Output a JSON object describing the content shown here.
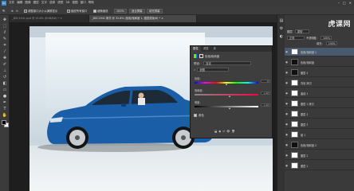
{
  "app": {
    "icon": "Ps"
  },
  "menu": [
    "文件",
    "编辑",
    "图像",
    "图层",
    "文字",
    "选择",
    "滤镜",
    "3D",
    "视图",
    "窗口",
    "帮助"
  ],
  "window_controls": [
    "minimize-icon",
    "maximize-icon",
    "close-icon"
  ],
  "options": {
    "checkbox1_label": "调整窗口大小以满屏显示",
    "checkbox2_label": "缩放所有窗口",
    "checkbox3_label": "细微缩放",
    "zoom_value": "100%",
    "fit_screen": "适合屏幕",
    "fill_screen": "填充屏幕"
  },
  "tabs": [
    {
      "label": "_DSC1941.psd @ 15.6% (RGB/8#) * ×",
      "active": false
    },
    {
      "label": "_DSC1941 拷贝 @ 32.8% (色相/饱和度 1, 图层蒙版/8) * ×",
      "active": true
    }
  ],
  "properties": {
    "tabs": [
      "属性",
      "调整",
      "库"
    ],
    "active_tab": "属性",
    "title": "色相/饱和度",
    "preset_label": "预设：",
    "preset_value": "自定",
    "channel_value": "全图",
    "hue_label": "色相：",
    "hue_value": "0",
    "saturation_label": "饱和度：",
    "saturation_value": "+12",
    "lightness_label": "明度：",
    "lightness_value": "+12",
    "colorize_label": "着色",
    "slider_levels": {
      "hue": 0.5,
      "saturation": 0.55,
      "lightness": 0.55
    }
  },
  "layers": {
    "header": "图层",
    "kind_label": "类型",
    "blend_mode": "正常",
    "opacity_label": "不透明度：",
    "opacity": "100%",
    "fill_label": "填充：",
    "fill": "100%",
    "items": [
      {
        "name": "色相/饱和度 1",
        "thumb": "light",
        "selected": true
      },
      {
        "name": "色相/饱和度",
        "thumb": "dark",
        "selected": false
      },
      {
        "name": "图层 4",
        "thumb": "dark",
        "selected": false
      },
      {
        "name": "背景 拷贝",
        "thumb": "light",
        "selected": false
      },
      {
        "name": "曲线 1",
        "thumb": "light",
        "selected": false
      },
      {
        "name": "图层 1 拷贝",
        "thumb": "light",
        "selected": false
      },
      {
        "name": "图层 2",
        "thumb": "light",
        "selected": false
      },
      {
        "name": "图层 3",
        "thumb": "light",
        "selected": false
      },
      {
        "name": "组 1",
        "thumb": "light",
        "selected": false
      },
      {
        "name": "色相/饱和度 2",
        "thumb": "dark",
        "selected": false
      },
      {
        "name": "图层 2",
        "thumb": "light",
        "selected": false
      },
      {
        "name": "图层 1",
        "thumb": "light",
        "selected": false
      }
    ]
  },
  "watermark": "虎课网",
  "colors": {
    "car_blue": "#1a5ea8",
    "panel_bg": "#3e3e3e",
    "ui_dark": "#282828"
  }
}
